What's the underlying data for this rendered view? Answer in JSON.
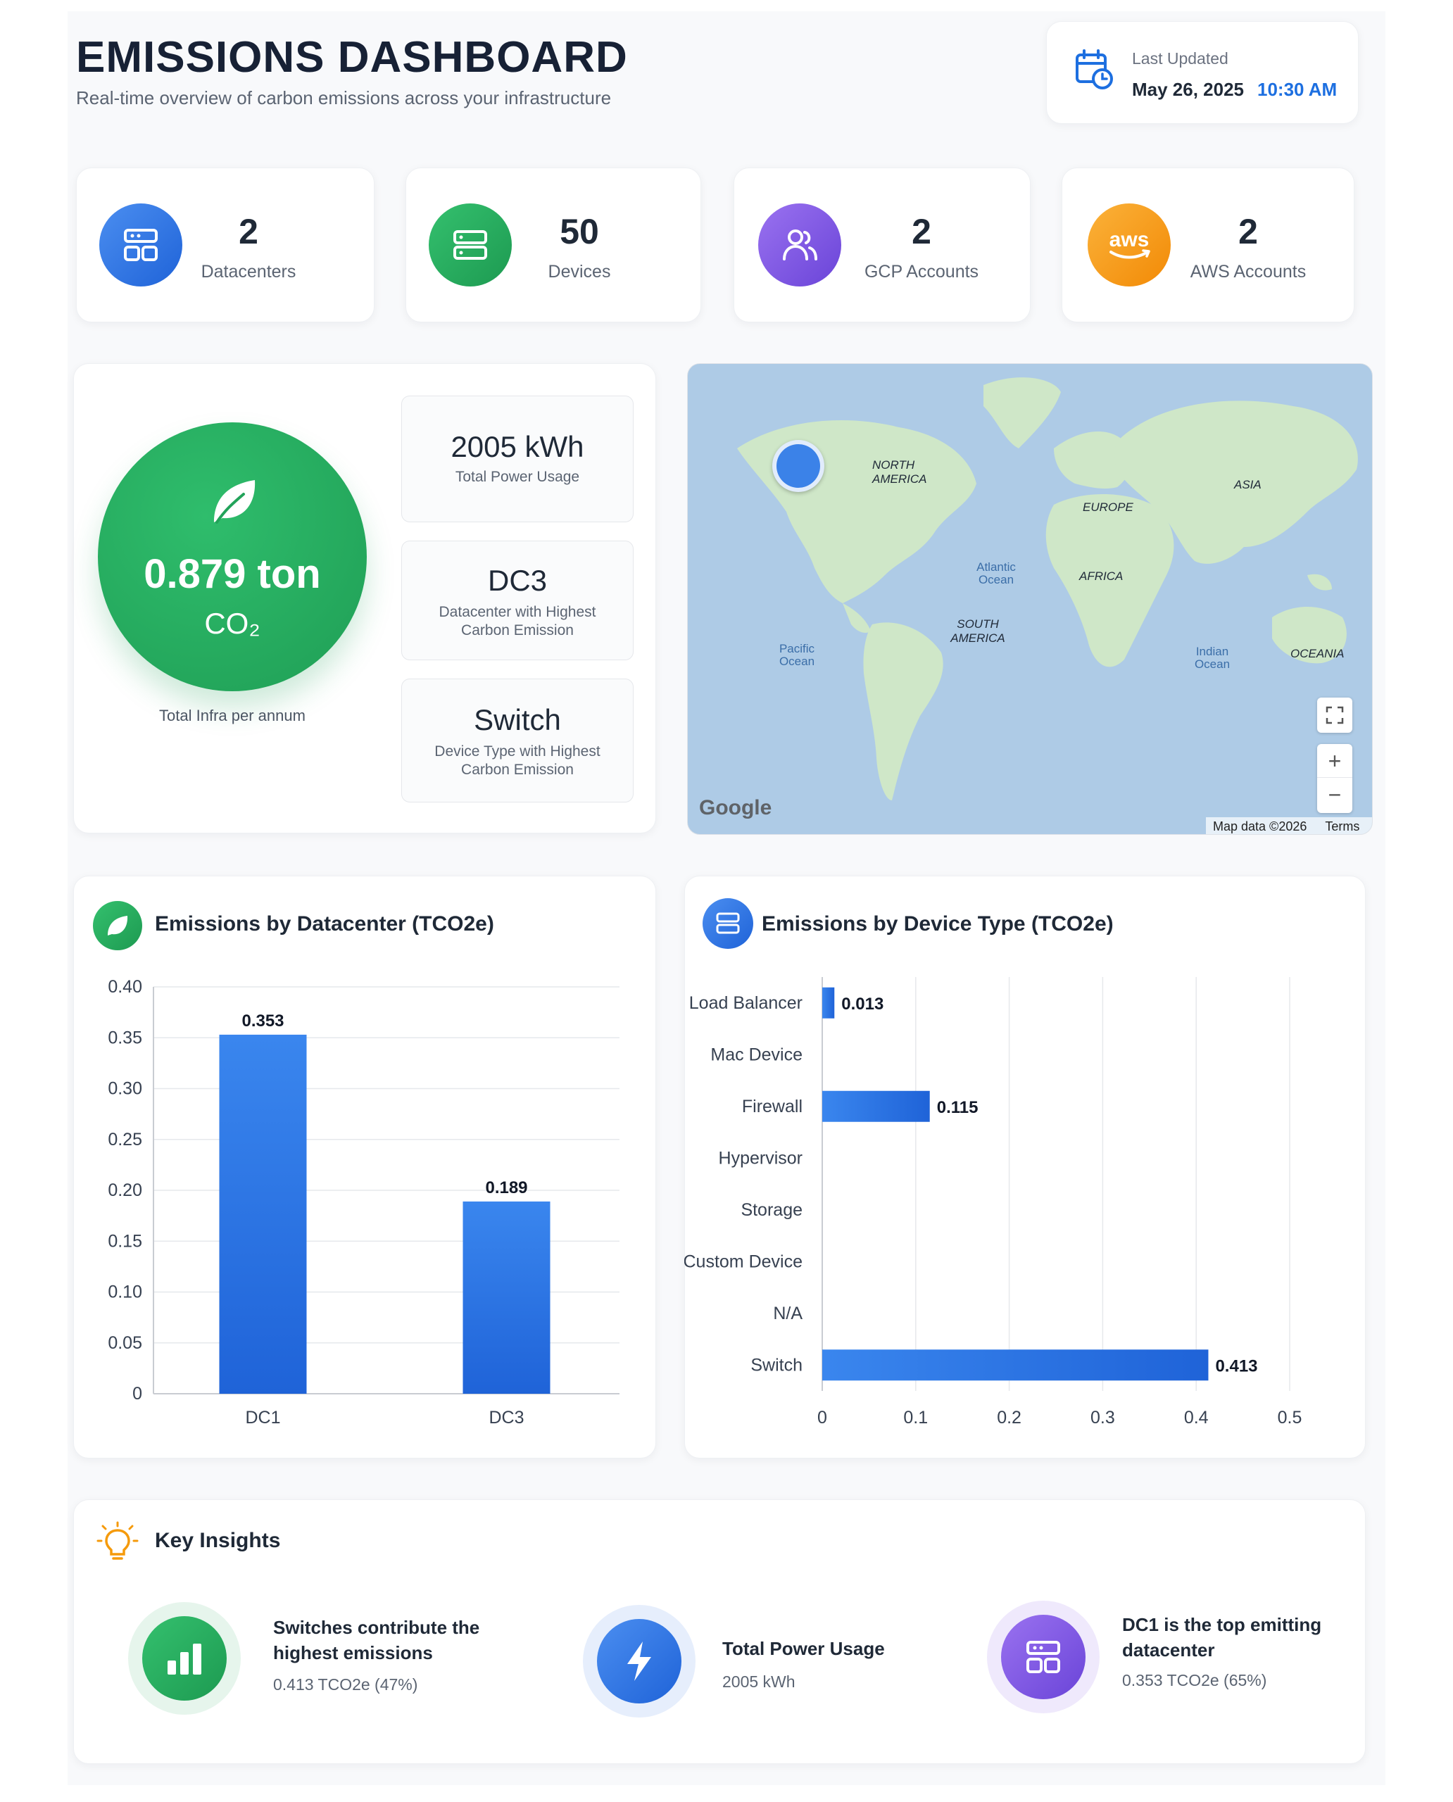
{
  "header": {
    "title": "EMISSIONS DASHBOARD",
    "subtitle": "Real-time overview of carbon emissions across your infrastructure",
    "last_updated_label": "Last Updated",
    "last_updated_date": "May 26, 2025",
    "last_updated_time": "10:30 AM"
  },
  "stats": [
    {
      "value": "2",
      "label": "Datacenters",
      "icon": "server-stack-icon",
      "color": "#2f73e6"
    },
    {
      "value": "50",
      "label": "Devices",
      "icon": "server-icon",
      "color": "#22a35a"
    },
    {
      "value": "2",
      "label": "GCP Accounts",
      "icon": "users-icon",
      "color": "#7b56e2"
    },
    {
      "value": "2",
      "label": "AWS Accounts",
      "icon": "aws-logo-icon",
      "color": "#f59a0b"
    }
  ],
  "emissions": {
    "value": "0.879 ton",
    "unit": "CO₂",
    "caption": "Total Infra per annum"
  },
  "mini_cards": [
    {
      "value": "2005 kWh",
      "label": "Total Power Usage"
    },
    {
      "value": "DC3",
      "label": "Datacenter with Highest Carbon Emission"
    },
    {
      "value": "Switch",
      "label": "Device Type with Highest Carbon Emission"
    }
  ],
  "map": {
    "labels": {
      "north_america": "NORTH AMERICA",
      "europe": "EUROPE",
      "asia": "ASIA",
      "africa": "AFRICA",
      "south_america": "SOUTH AMERICA",
      "oceania": "OCEANIA",
      "atlantic": "Atlantic Ocean",
      "pacific": "Pacific Ocean",
      "indian": "Indian Ocean"
    },
    "brand": "Google",
    "attribution": "Map data ©2026",
    "terms": "Terms",
    "zoom_in": "+",
    "zoom_out": "−"
  },
  "chart_dc_title": "Emissions by Datacenter (TCO2e)",
  "chart_dev_title": "Emissions by Device Type (TCO2e)",
  "chart_data": [
    {
      "type": "bar",
      "title": "Emissions by Datacenter (TCO2e)",
      "categories": [
        "DC1",
        "DC3"
      ],
      "values": [
        0.353,
        0.189
      ],
      "value_labels": [
        "0.353",
        "0.189"
      ],
      "ylim": [
        0,
        0.4
      ],
      "yticks": [
        "0",
        "0.05",
        "0.10",
        "0.15",
        "0.20",
        "0.25",
        "0.30",
        "0.35",
        "0.40"
      ],
      "grid": true
    },
    {
      "type": "bar",
      "orientation": "horizontal",
      "title": "Emissions by Device Type (TCO2e)",
      "categories": [
        "Load Balancer",
        "Mac Device",
        "Firewall",
        "Hypervisor",
        "Storage",
        "Custom Device",
        "N/A",
        "Switch"
      ],
      "values": [
        0.013,
        null,
        0.115,
        null,
        null,
        null,
        null,
        0.413
      ],
      "value_labels": [
        "0.013",
        "",
        "0.115",
        "",
        "",
        "",
        "",
        "0.413"
      ],
      "xlim": [
        0,
        0.5
      ],
      "xticks": [
        "0",
        "0.1",
        "0.2",
        "0.3",
        "0.4",
        "0.5"
      ],
      "grid": true
    }
  ],
  "insights": {
    "title": "Key Insights",
    "items": [
      {
        "title": "Switches contribute the highest emissions",
        "sub": "0.413 TCO2e (47%)",
        "icon": "bar-chart-icon",
        "color": "#22a35a"
      },
      {
        "title": "Total Power Usage",
        "sub": "2005 kWh",
        "icon": "lightning-icon",
        "color": "#2f73e6"
      },
      {
        "title": "DC1 is the top emitting datacenter",
        "sub": "0.353 TCO2e (65%)",
        "icon": "server-stack-icon",
        "color": "#7b56e2"
      }
    ]
  }
}
